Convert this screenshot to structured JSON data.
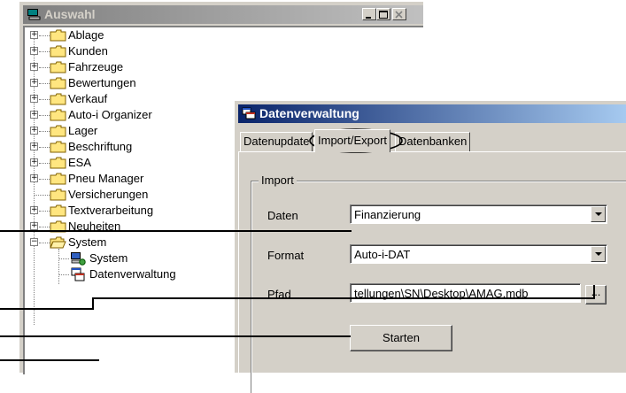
{
  "auswahl_window": {
    "title": "Auswahl",
    "minimize_label": "_",
    "maximize_label": "□",
    "close_label": "×",
    "tree": [
      {
        "label": "Ablage",
        "expander": "+"
      },
      {
        "label": "Kunden",
        "expander": "+"
      },
      {
        "label": "Fahrzeuge",
        "expander": "+"
      },
      {
        "label": "Bewertungen",
        "expander": "+"
      },
      {
        "label": "Verkauf",
        "expander": "+"
      },
      {
        "label": "Auto-i Organizer",
        "expander": "+"
      },
      {
        "label": "Lager",
        "expander": "+"
      },
      {
        "label": "Beschriftung",
        "expander": "+"
      },
      {
        "label": "ESA",
        "expander": "+"
      },
      {
        "label": "Pneu Manager",
        "expander": "+"
      },
      {
        "label": "Versicherungen",
        "expander": ""
      },
      {
        "label": "Textverarbeitung",
        "expander": "+"
      },
      {
        "label": "Neuheiten",
        "expander": "+"
      },
      {
        "label": "System",
        "expander": "−"
      }
    ],
    "subtree": [
      {
        "label": "System"
      },
      {
        "label": "Datenverwaltung"
      }
    ]
  },
  "dv_window": {
    "title": "Datenverwaltung",
    "tabs": [
      "Datenupdate",
      "Import/Export",
      "Datenbanken"
    ],
    "active_tab": "Import/Export",
    "group_title": "Import",
    "daten_label": "Daten",
    "daten_value": "Finanzierung",
    "format_label": "Format",
    "format_value": "Auto-i-DAT",
    "pfad_label": "Pfad",
    "pfad_value": "tellungen\\SN\\Desktop\\AMAG.mdb",
    "browse_label": "...",
    "start_label": "Starten"
  },
  "colors": {
    "active_title": "#0a246a",
    "inactive_title": "#808080",
    "face": "#d4d0c8"
  }
}
